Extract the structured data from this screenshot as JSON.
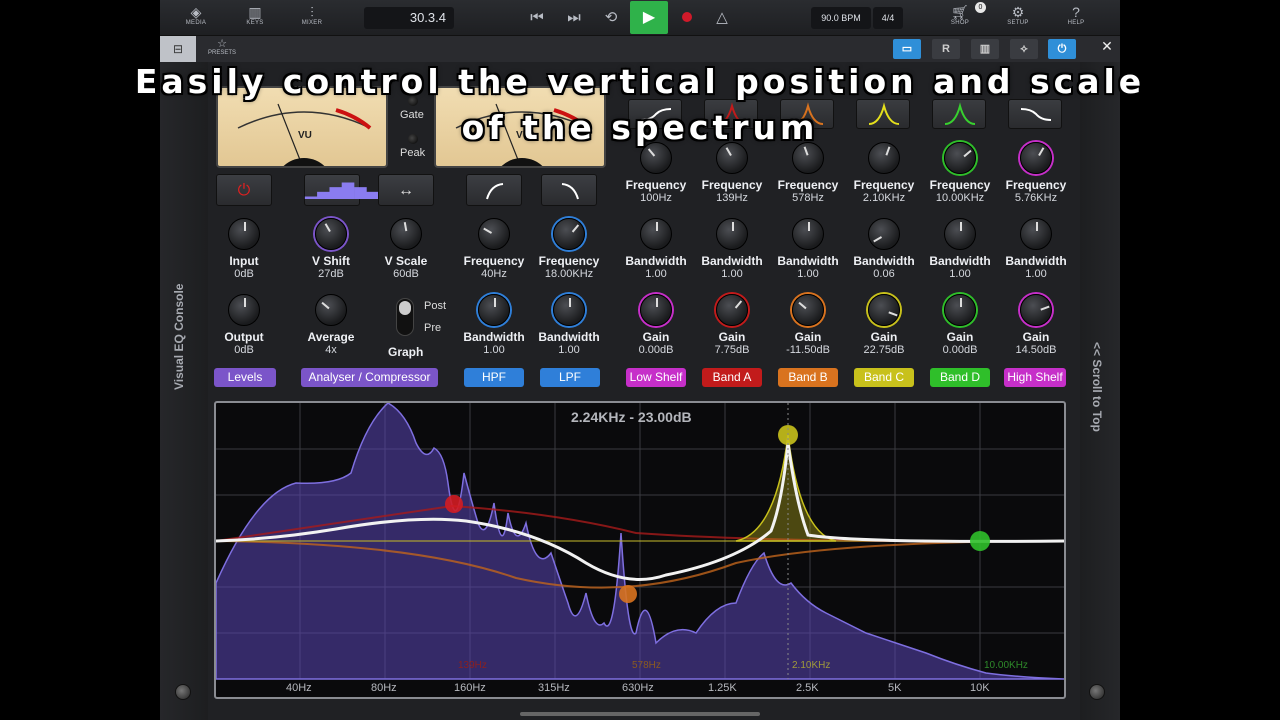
{
  "toolbar": {
    "media": "MEDIA",
    "keys": "KEYS",
    "mixer": "MIXER",
    "time": "30.3.4",
    "tempo": "90.0 BPM",
    "signature": "4/4",
    "shop": "SHOP",
    "shop_badge": "0",
    "setup": "SETUP",
    "help": "HELP",
    "icons": {
      "media": "media-icon",
      "keys": "keys-icon",
      "mixer": "mixer-icon",
      "rewind": "skip-back-icon",
      "forward": "skip-forward-icon",
      "loop": "loop-icon",
      "play": "play-icon",
      "record": "record-icon",
      "metronome": "metronome-icon",
      "shop": "cart-icon",
      "setup": "gear-icon",
      "help": "help-icon"
    }
  },
  "subbar": {
    "presets": "PRESETS",
    "r_label": "R",
    "power_color": "#2f8fd8"
  },
  "panel": {
    "left_title": "Visual EQ Console",
    "right_title": "<< Scroll to Top",
    "meter_label": "VU",
    "gate": "Gate",
    "peak": "Peak",
    "post": "Post",
    "pre": "Pre"
  },
  "knobs": {
    "input": {
      "label": "Input",
      "value": "0dB"
    },
    "output": {
      "label": "Output",
      "value": "0dB"
    },
    "vshift": {
      "label": "V Shift",
      "value": "27dB"
    },
    "average": {
      "label": "Average",
      "value": "4x"
    },
    "vscale": {
      "label": "V Scale",
      "value": "60dB"
    },
    "graph": {
      "label": "Graph"
    },
    "hpf_freq": {
      "label": "Frequency",
      "value": "40Hz"
    },
    "hpf_bw": {
      "label": "Bandwidth",
      "value": "1.00"
    },
    "lpf_freq": {
      "label": "Frequency",
      "value": "18.00KHz"
    },
    "lpf_bw": {
      "label": "Bandwidth",
      "value": "1.00"
    },
    "bands": [
      {
        "name": "Low Shelf",
        "color": "#c62fc9",
        "freq": "100Hz",
        "bw": "1.00",
        "gain": "0.00dB"
      },
      {
        "name": "Band A",
        "color": "#c21b1b",
        "freq": "139Hz",
        "bw": "1.00",
        "gain": "7.75dB"
      },
      {
        "name": "Band B",
        "color": "#d9731f",
        "freq": "578Hz",
        "bw": "1.00",
        "gain": "-11.50dB"
      },
      {
        "name": "Band C",
        "color": "#c8c11c",
        "freq": "2.10KHz",
        "bw": "0.06",
        "gain": "22.75dB"
      },
      {
        "name": "Band D",
        "color": "#2fbf2a",
        "freq": "10.00KHz",
        "bw": "1.00",
        "gain": "0.00dB"
      },
      {
        "name": "High Shelf",
        "color": "#c62fc9",
        "freq": "5.76KHz",
        "bw": "1.00",
        "gain": "14.50dB"
      }
    ],
    "freq_label": "Frequency",
    "bw_label": "Bandwidth",
    "gain_label": "Gain"
  },
  "sections": {
    "levels": "Levels",
    "analyser": "Analyser / Compressor",
    "hpf": "HPF",
    "lpf": "LPF",
    "levels_color": "#7b55c9",
    "analyser_color": "#7b55c9",
    "filter_color": "#2f7fd9"
  },
  "graph": {
    "readout": "2.24KHz - 23.00dB",
    "freq_labels": [
      "40Hz",
      "80Hz",
      "160Hz",
      "315Hz",
      "630Hz",
      "1.25K",
      "2.5K",
      "5K",
      "10K"
    ],
    "band_labels": [
      {
        "text": "139Hz",
        "color": "#8a2020"
      },
      {
        "text": "578Hz",
        "color": "#8a5a20"
      },
      {
        "text": "2.10KHz",
        "color": "#a09a3a"
      },
      {
        "text": "10.00KHz",
        "color": "#2e8a2a"
      }
    ]
  },
  "caption": {
    "line1": "Easily control the vertical position and scale",
    "line2": "of the spectrum"
  }
}
